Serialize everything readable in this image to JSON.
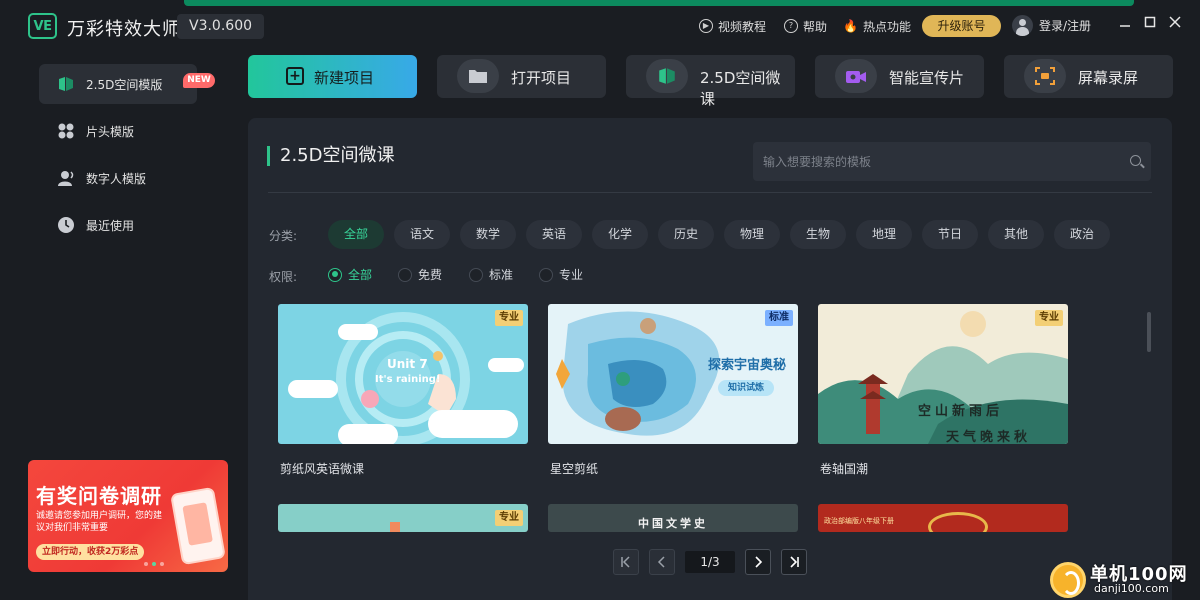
{
  "app": {
    "logo_text": "VE",
    "name": "万彩特效大师",
    "version": "V3.0.600"
  },
  "titlebar": {
    "tutorial": "视频教程",
    "help": "帮助",
    "hot": "热点功能",
    "upgrade": "升级账号",
    "login": "登录/注册"
  },
  "sidebar": {
    "items": [
      {
        "label": "2.5D空间模版",
        "icon": "cube-icon"
      },
      {
        "label": "片头模版",
        "icon": "grid-icon"
      },
      {
        "label": "数字人模版",
        "icon": "digital-human-icon"
      },
      {
        "label": "最近使用",
        "icon": "clock-icon"
      }
    ],
    "new_badge": "NEW"
  },
  "banner": {
    "title": "有奖问卷调研",
    "desc": "诚邀请您参加用户调研，您的建议对我们非常重要",
    "cta": "立即行动，收获2万彩点"
  },
  "actions": [
    {
      "label": "新建项目"
    },
    {
      "label": "打开项目"
    },
    {
      "label": "2.5D空间微课"
    },
    {
      "label": "智能宣传片"
    },
    {
      "label": "屏幕录屏"
    }
  ],
  "panel": {
    "title": "2.5D空间微课",
    "search_placeholder": "输入想要搜索的模板"
  },
  "filters": {
    "category_label": "分类:",
    "categories": [
      "全部",
      "语文",
      "数学",
      "英语",
      "化学",
      "历史",
      "物理",
      "生物",
      "地理",
      "节日",
      "其他",
      "政治"
    ],
    "permission_label": "权限:",
    "permissions": [
      "全部",
      "免费",
      "标准",
      "专业"
    ]
  },
  "cards": [
    {
      "title": "剪纸风英语微课",
      "tag": "专业",
      "art1": "Unit 7",
      "art2": "It's raining!"
    },
    {
      "title": "星空剪纸",
      "tag": "标准",
      "art1": "探索宇宙奥秘",
      "art2": "知识试炼"
    },
    {
      "title": "卷轴国潮",
      "tag": "专业",
      "art1": "空山新雨后",
      "art2": "天气晚来秋"
    },
    {
      "tag": "专业"
    },
    {
      "art1": "中国文学史"
    },
    {
      "art1": "政治部编版八年级下册"
    }
  ],
  "pager": {
    "current": "1/3"
  },
  "watermark": {
    "name": "单机100网",
    "url": "danji100.com"
  },
  "colors": {
    "accent": "#2ec38a",
    "upgrade": "#e0b657",
    "pro_tag": "#f3cf75",
    "std_tag": "#7bb0ff"
  }
}
